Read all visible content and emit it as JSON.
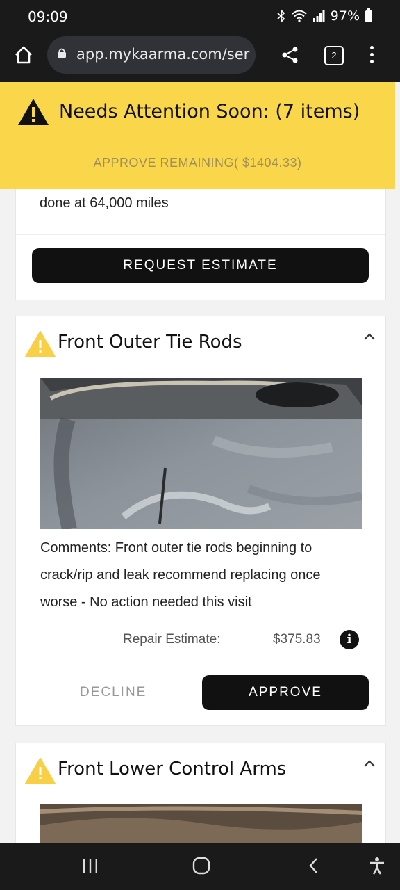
{
  "status_bar": {
    "time": "09:09",
    "battery": "97%",
    "icons": [
      "bluetooth-icon",
      "wifi-icon",
      "signal-icon",
      "battery-icon"
    ]
  },
  "browser": {
    "url": "app.mykaarma.com/ser",
    "tab_count": "2",
    "icons": [
      "home-icon",
      "lock-icon",
      "share-icon",
      "tabs-icon",
      "more-menu-icon"
    ]
  },
  "banner": {
    "title": "Needs Attention Soon: (7 items)",
    "approve_remaining": "APPROVE REMAINING( $1404.33)",
    "color": "#f9d64a"
  },
  "card_prev": {
    "text_tail": "done at 64,000 miles",
    "request_button": "REQUEST ESTIMATE"
  },
  "items": [
    {
      "title": "Front Outer Tie Rods",
      "comments": "Comments: Front outer tie rods beginning to crack/rip and leak recommend replacing once worse - No action needed this visit",
      "estimate_label": "Repair Estimate:",
      "estimate_value": "$375.83",
      "decline_label": "DECLINE",
      "approve_label": "APPROVE"
    },
    {
      "title": "Front Lower Control Arms"
    }
  ],
  "nav_bar": {
    "icons": [
      "recents-icon",
      "home-circle-icon",
      "back-icon",
      "accessibility-icon"
    ]
  }
}
